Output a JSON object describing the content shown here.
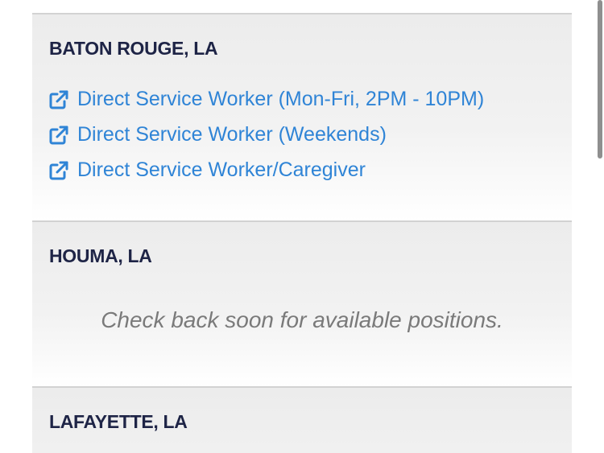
{
  "locations": [
    {
      "city": "BATON ROUGE, LA",
      "jobs": [
        {
          "label": "Direct Service Worker (Mon-Fri, 2PM - 10PM)",
          "icon": "external-link-icon"
        },
        {
          "label": "Direct Service Worker (Weekends)",
          "icon": "external-link-icon"
        },
        {
          "label": "Direct Service Worker/Caregiver",
          "icon": "external-link-icon"
        }
      ]
    },
    {
      "city": "HOUMA, LA",
      "empty_message": "Check back soon for available positions."
    },
    {
      "city": "LAFAYETTE, LA"
    }
  ],
  "colors": {
    "city_text": "#1e2446",
    "link": "#2f84d6",
    "muted_text": "#7a7a7a",
    "card_bg": "#ececec",
    "divider": "#d2d2d2"
  }
}
